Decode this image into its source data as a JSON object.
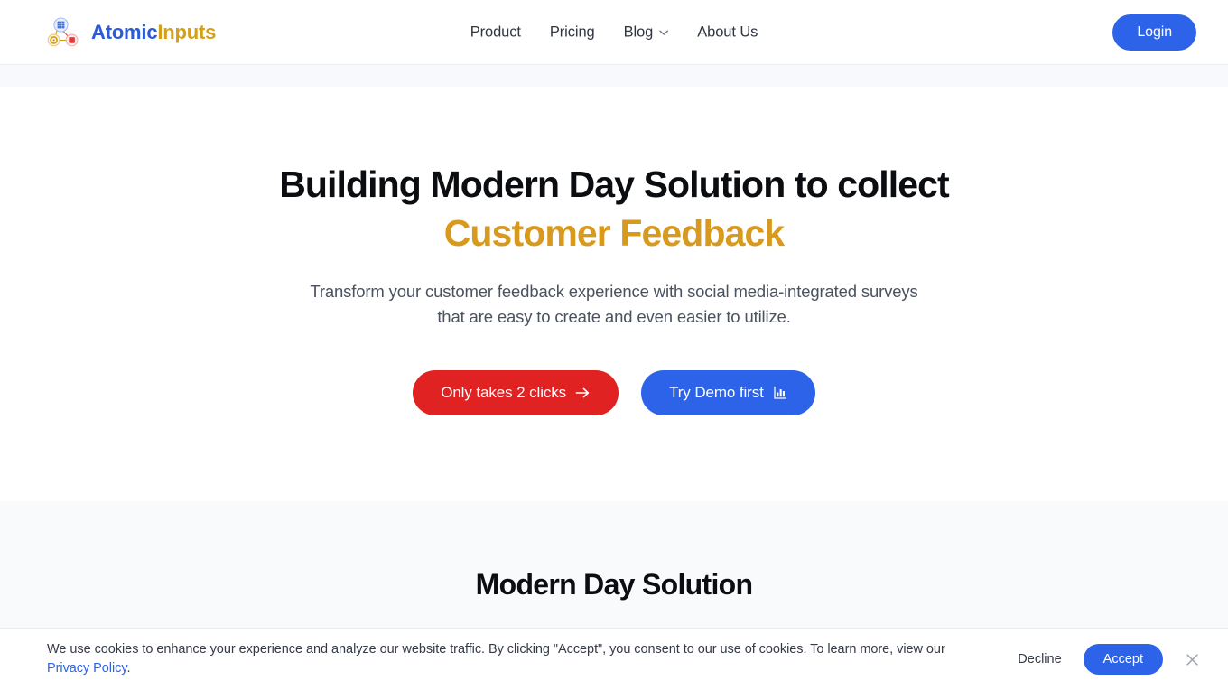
{
  "header": {
    "brand": {
      "name_part1": "Atomic",
      "name_part2": "Inputs",
      "logo_icon": "network-nodes-logo-icon"
    },
    "nav": [
      {
        "label": "Product",
        "icon": null
      },
      {
        "label": "Pricing",
        "icon": null
      },
      {
        "label": "Blog",
        "icon": "chevron-down-icon"
      },
      {
        "label": "About Us",
        "icon": null
      }
    ],
    "login_label": "Login"
  },
  "hero": {
    "title_line1": "Building Modern Day Solution to collect",
    "title_accent": "Customer Feedback",
    "subtitle": "Transform your customer feedback experience with social media-integrated surveys that are easy to create and even easier to utilize.",
    "primary_cta": {
      "label": "Only takes 2 clicks",
      "icon": "arrow-right-icon"
    },
    "secondary_cta": {
      "label": "Try Demo first",
      "icon": "bar-chart-icon"
    }
  },
  "section2": {
    "title": "Modern Day Solution"
  },
  "cookie_banner": {
    "text_before_link": "We use cookies to enhance your experience and analyze our website traffic. By clicking \"Accept\", you consent to our use of cookies. To learn more, view our ",
    "link_label": "Privacy Policy",
    "text_after_link": ".",
    "decline_label": "Decline",
    "accept_label": "Accept",
    "close_icon": "close-icon"
  },
  "colors": {
    "brand_blue": "#2B5BD7",
    "brand_gold": "#D4A017",
    "accent_gold": "#D89A1E",
    "button_blue": "#2D63E8",
    "button_red": "#E02222",
    "section_bg": "#F8FAFC",
    "strip_bg": "#F8F9FC",
    "text_dark": "#0B0D11",
    "text_muted": "#4A5260"
  }
}
